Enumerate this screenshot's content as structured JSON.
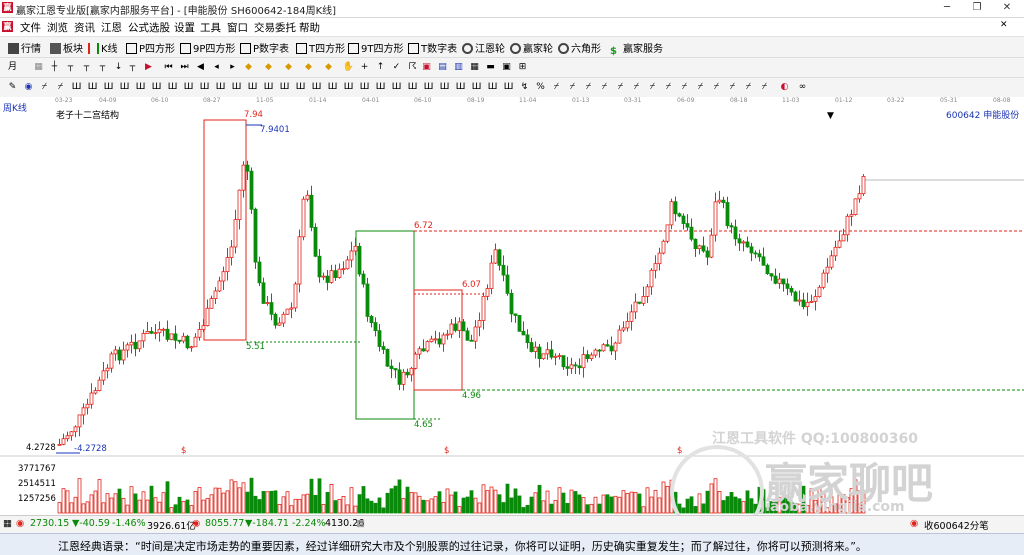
{
  "window": {
    "title": "赢家江恩专业版[赢家内部服务平台] - [申能股份  SH600642-184周K线]",
    "minimize": "─",
    "restore": "❐",
    "close": "✕"
  },
  "menu": [
    "文件",
    "浏览",
    "资讯",
    "江恩",
    "公式选股",
    "设置",
    "工具",
    "窗口",
    "交易委托",
    "帮助"
  ],
  "toolbar": [
    "行情",
    "板块",
    "K线",
    "P四方形",
    "9P四方形",
    "P数字表",
    "T四方形",
    "9T四方形",
    "T数字表",
    "江恩轮",
    "赢家轮",
    "六角形",
    "赢家服务"
  ],
  "dates": [
    "03-23",
    "04-09",
    "06-10",
    "08-27",
    "11-05",
    "01-14",
    "04-01",
    "06-10",
    "08-19",
    "11-04",
    "01-13",
    "03-31",
    "06-09",
    "08-18",
    "11-03",
    "01-12",
    "03-22",
    "05-31",
    "08-08"
  ],
  "chart": {
    "period_label": "周K线",
    "structure_label": "老子十二宫结构",
    "stock_label": "600642 申能股份",
    "levels": {
      "high1": "7.94",
      "high1_alt": "7.9401",
      "low1": "5.51",
      "mid_top": "6.72",
      "mid_high": "6.07",
      "mid_low": "4.96",
      "mid_bottom": "4.65",
      "low_start": "4.2728",
      "low_start_alt": "-4.2728"
    },
    "dollar_sign": "$",
    "volume_axis": [
      "3771767",
      "2514511",
      "1257256"
    ],
    "watermarks": {
      "tool": "江恩工具软件  QQ:100800360",
      "brand": "赢家聊吧",
      "url": "Jiaoba.yingjia.com"
    }
  },
  "status": {
    "index1_value": "2730.15",
    "index1_change": "▼-40.59",
    "index1_pct": "-1.46%",
    "index1_vol": "3926.61亿",
    "index2_value": "8055.77",
    "index2_change": "▼-184.71",
    "index2_pct": "-2.24%",
    "index2_vol": "4130.26",
    "right": "收600642分笔"
  },
  "quote": "江恩经典语录：“时间是决定市场走势的重要因素，经过详细研究大市及个别股票的过往记录，你将可以证明，历史确实重复发生；而了解过往，你将可以预测将来。”。",
  "colors": {
    "up": "#e2231a",
    "down": "#0a8a0a",
    "accent": "#1a33b5"
  }
}
